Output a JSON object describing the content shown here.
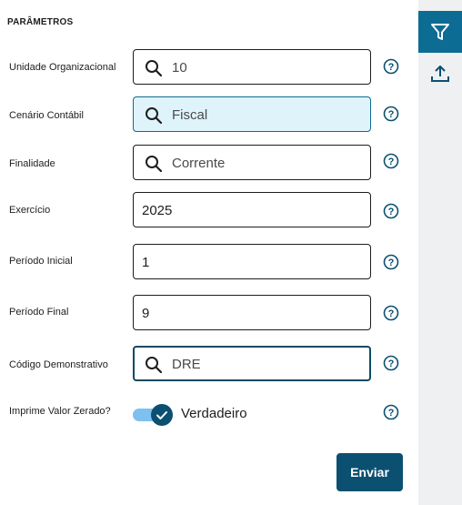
{
  "section": {
    "title": "PARÂMETROS"
  },
  "fields": [
    {
      "label": "Unidade Organizacional",
      "value": "10",
      "type": "lookup"
    },
    {
      "label": "Cenário Contábil",
      "value": "Fiscal",
      "type": "lookup"
    },
    {
      "label": "Finalidade",
      "value": "Corrente",
      "type": "lookup"
    },
    {
      "label": "Exercício",
      "value": "2025",
      "type": "text"
    },
    {
      "label": "Período Inicial",
      "value": "1",
      "type": "text"
    },
    {
      "label": "Período Final",
      "value": "9",
      "type": "text"
    },
    {
      "label": "Código Demonstrativo",
      "value": "DRE",
      "type": "lookup"
    }
  ],
  "toggle": {
    "label": "Imprime Valor Zerado?",
    "state_text": "Verdadeiro",
    "checked": true
  },
  "submit": {
    "label": "Enviar"
  },
  "sidebar": {
    "items": [
      {
        "icon": "filter-icon",
        "active": true
      },
      {
        "icon": "upload-icon",
        "active": false
      }
    ]
  },
  "colors": {
    "primary": "#0b5071",
    "accent": "#0c6c94",
    "selected_bg": "#dff3fb",
    "toggle_track": "#7ec0f0"
  }
}
